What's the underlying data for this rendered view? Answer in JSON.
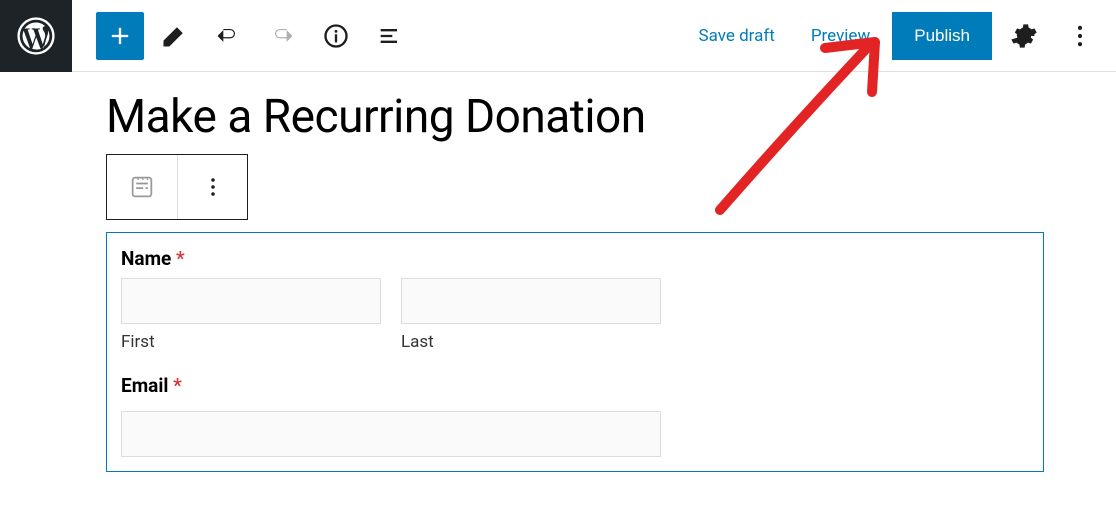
{
  "topbar": {
    "save_draft": "Save draft",
    "preview": "Preview",
    "publish": "Publish"
  },
  "page_title": "Make a Recurring Donation",
  "form": {
    "name_label": "Name",
    "required_mark": "*",
    "first_sublabel": "First",
    "last_sublabel": "Last",
    "email_label": "Email"
  }
}
